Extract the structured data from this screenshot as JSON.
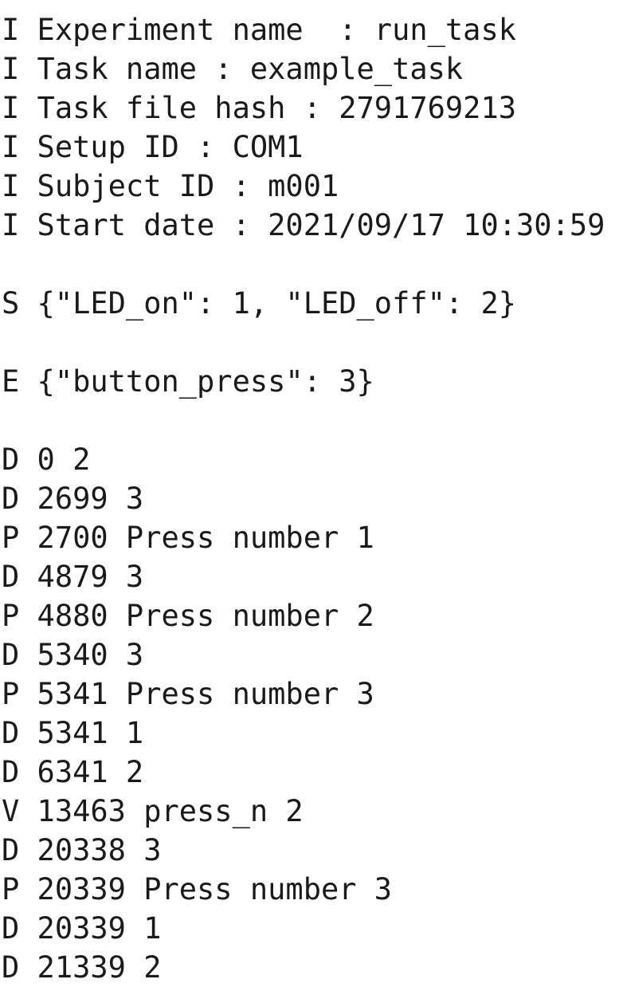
{
  "document": {
    "kind": "plain-text-data-file",
    "background_color": "#ffffff",
    "text_color": "#1a1a1a",
    "font_size_px": 37,
    "line_height_px": 49
  },
  "info_block": {
    "line_type_code": "I",
    "entries": [
      {
        "key": "Experiment name",
        "separator": ":",
        "value": "run_task"
      },
      {
        "key": "Task name",
        "separator": ":",
        "value": "example_task"
      },
      {
        "key": "Task file hash",
        "separator": ":",
        "value": "2791769213"
      },
      {
        "key": "Setup ID",
        "separator": ":",
        "value": "COM1"
      },
      {
        "key": "Subject ID",
        "separator": ":",
        "value": "m001"
      },
      {
        "key": "Start date",
        "separator": ":",
        "value": "2021/09/17 10:30:59"
      }
    ]
  },
  "states_block": {
    "line_type_code": "S",
    "states": [
      {
        "name": "LED_on",
        "id": 1
      },
      {
        "name": "LED_off",
        "id": 2
      }
    ]
  },
  "events_block": {
    "line_type_code": "E",
    "events": [
      {
        "name": "button_press",
        "id": 3
      }
    ]
  },
  "data_block": {
    "records": [
      {
        "code": "D",
        "timestamp": "0",
        "payload": "2"
      },
      {
        "code": "D",
        "timestamp": "2699",
        "payload": "3"
      },
      {
        "code": "P",
        "timestamp": "2700",
        "payload": "Press number 1"
      },
      {
        "code": "D",
        "timestamp": "4879",
        "payload": "3"
      },
      {
        "code": "P",
        "timestamp": "4880",
        "payload": "Press number 2"
      },
      {
        "code": "D",
        "timestamp": "5340",
        "payload": "3"
      },
      {
        "code": "P",
        "timestamp": "5341",
        "payload": "Press number 3"
      },
      {
        "code": "D",
        "timestamp": "5341",
        "payload": "1"
      },
      {
        "code": "D",
        "timestamp": "6341",
        "payload": "2"
      },
      {
        "code": "V",
        "timestamp": "13463",
        "payload": "press_n 2"
      },
      {
        "code": "D",
        "timestamp": "20338",
        "payload": "3"
      },
      {
        "code": "P",
        "timestamp": "20339",
        "payload": "Press number 3"
      },
      {
        "code": "D",
        "timestamp": "20339",
        "payload": "1"
      },
      {
        "code": "D",
        "timestamp": "21339",
        "payload": "2"
      }
    ]
  },
  "rendered_lines": [
    "I Experiment name  : run_task",
    "I Task name : example_task",
    "I Task file hash : 2791769213",
    "I Setup ID : COM1",
    "I Subject ID : m001",
    "I Start date : 2021/09/17 10:30:59",
    "",
    "S {\"LED_on\": 1, \"LED_off\": 2}",
    "",
    "E {\"button_press\": 3}",
    "",
    "D 0 2",
    "D 2699 3",
    "P 2700 Press number 1",
    "D 4879 3",
    "P 4880 Press number 2",
    "D 5340 3",
    "P 5341 Press number 3",
    "D 5341 1",
    "D 6341 2",
    "V 13463 press_n 2",
    "D 20338 3",
    "P 20339 Press number 3",
    "D 20339 1",
    "D 21339 2"
  ]
}
